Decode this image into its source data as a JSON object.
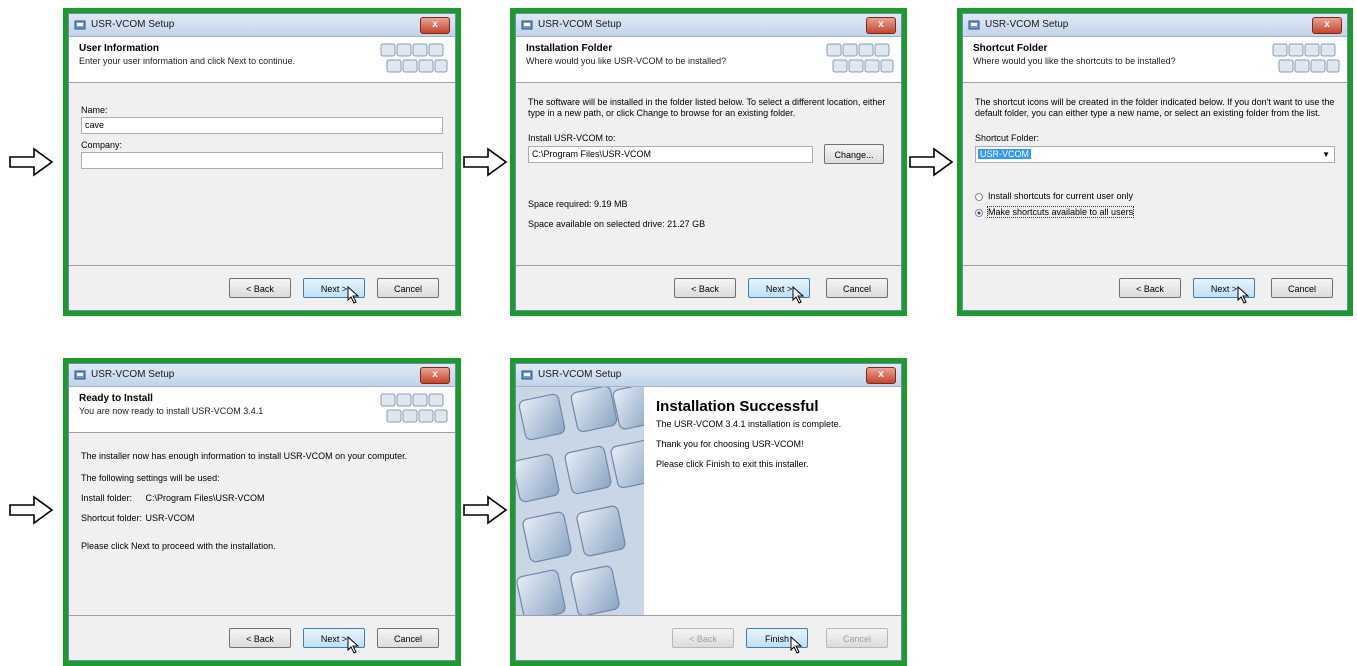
{
  "window_title": "USR-VCOM Setup",
  "close_label": "x",
  "nav": {
    "back": "< Back",
    "next": "Next >",
    "cancel": "Cancel",
    "finish": "Finish"
  },
  "step1": {
    "title": "User Information",
    "subtitle": "Enter your user information and click Next to continue.",
    "name_label": "Name:",
    "name_value": "cave",
    "company_label": "Company:",
    "company_value": ""
  },
  "step2": {
    "title": "Installation Folder",
    "subtitle": "Where would you like USR-VCOM to be installed?",
    "desc": "The software will be installed in the folder listed below. To select a different location, either type in a new path, or click Change to browse for an existing folder.",
    "install_label": "Install USR-VCOM to:",
    "install_path": "C:\\Program Files\\USR-VCOM",
    "change_button": "Change...",
    "space_required": "Space required: 9.19 MB",
    "space_available": "Space available on selected drive: 21.27 GB"
  },
  "step3": {
    "title": "Shortcut Folder",
    "subtitle": "Where would you like the shortcuts to be installed?",
    "desc": "The shortcut icons will be created in the folder indicated below. If you don't want to use the default folder, you can either type a new name, or select an existing folder from the list.",
    "folder_label": "Shortcut Folder:",
    "folder_value": "USR-VCOM",
    "option_current": "Install shortcuts for current user only",
    "option_all": "Make shortcuts available to all users"
  },
  "step4": {
    "title": "Ready to Install",
    "subtitle": "You are now ready to install USR-VCOM 3.4.1",
    "desc": "The installer now has enough information to install USR-VCOM on your computer.",
    "settings_intro": "The following settings will be used:",
    "install_folder_label": "Install folder:",
    "install_folder_value": "C:\\Program Files\\USR-VCOM",
    "shortcut_folder_label": "Shortcut folder:",
    "shortcut_folder_value": "USR-VCOM",
    "proceed": "Please click Next to proceed with the installation."
  },
  "step5": {
    "title": "Installation Successful",
    "line1": "The USR-VCOM 3.4.1 installation is complete.",
    "line2": "Thank you for choosing USR-VCOM!",
    "line3": "Please click Finish to exit this installer."
  },
  "colors": {
    "frame": "#1c9a2c",
    "accent": "#3399ff"
  }
}
